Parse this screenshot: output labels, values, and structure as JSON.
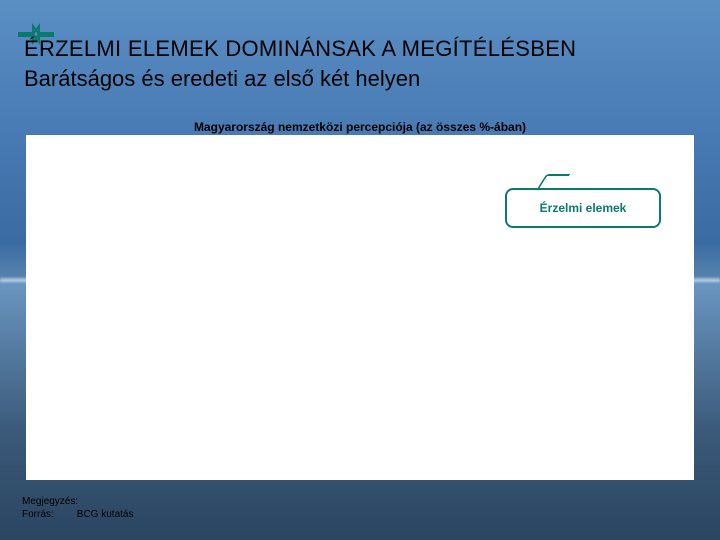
{
  "title": "ÉRZELMI ELEMEK DOMINÁNSAK A MEGÍTÉLÉSBEN",
  "subtitle": "Barátságos és eredeti az első két helyen",
  "chart_title": "Magyarország nemzetközi percepciója (az összes %-ában)",
  "callout": "Érzelmi elemek",
  "notes": {
    "note_label": "Megjegyzés:",
    "note_value": "",
    "source_label": "Forrás:",
    "source_value": "BCG kutatás"
  },
  "chart_data": {
    "type": "bar",
    "title": "Magyarország nemzetközi percepciója (az összes %-ában)",
    "xlabel": "",
    "ylabel": "%",
    "categories": [],
    "values": [],
    "ylim": [
      0,
      100
    ],
    "annotations": [
      "Érzelmi elemek"
    ]
  }
}
